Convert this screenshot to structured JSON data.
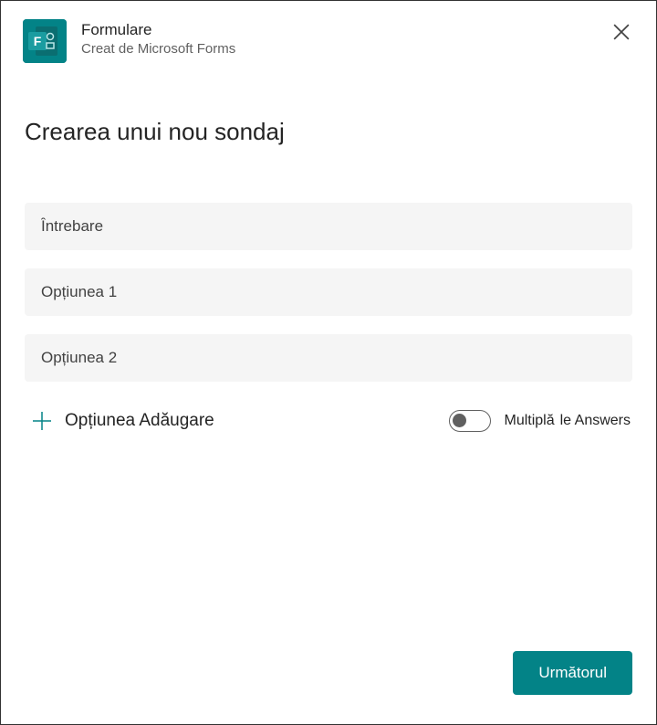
{
  "header": {
    "app_title": "Formulare",
    "app_subtitle": "Creat de Microsoft Forms"
  },
  "main": {
    "page_title": "Crearea unui nou sondaj",
    "question_placeholder": "Întrebare",
    "question_value": "",
    "options": [
      {
        "placeholder": "Opțiunea 1",
        "value": ""
      },
      {
        "placeholder": "Opțiunea 2",
        "value": ""
      }
    ],
    "add_option_label": "Opțiunea Adăugare",
    "toggle": {
      "state": "off",
      "label_primary": "Multiplă",
      "label_secondary": "le Answers"
    }
  },
  "footer": {
    "next_label": "Următorul"
  },
  "colors": {
    "accent": "#038387",
    "field_bg": "#f5f5f5"
  }
}
